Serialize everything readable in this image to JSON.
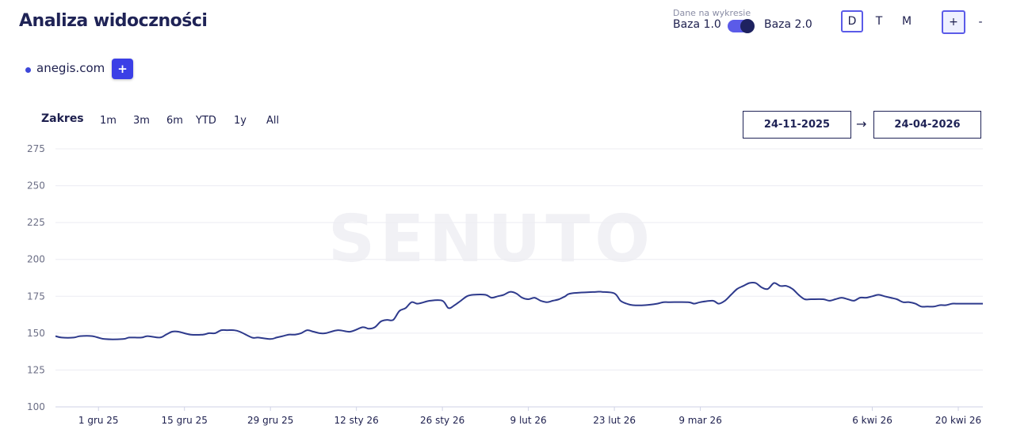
{
  "header": {
    "title": "Analiza widoczności",
    "data_label": "Dane na wykresie",
    "baza1": "Baza 1.0",
    "baza2": "Baza 2.0",
    "granularity": [
      "D",
      "T",
      "M"
    ],
    "granularity_active": "D",
    "zoom_in": "+",
    "zoom_out": "-"
  },
  "domain": {
    "name": "anegis.com",
    "add_label": "+",
    "color": "#3d47d9"
  },
  "range": {
    "label": "Zakres",
    "options": [
      "1m",
      "3m",
      "6m",
      "YTD",
      "1y",
      "All"
    ],
    "date_from": "24-11-2025",
    "arrow": "→",
    "date_to": "24-04-2026"
  },
  "watermark": "SENUTO",
  "chart_data": {
    "type": "line",
    "ylim": [
      100,
      275
    ],
    "y_ticks": [
      100,
      125,
      150,
      175,
      200,
      225,
      250,
      275
    ],
    "x_range": [
      "2025-11-24",
      "2026-04-24"
    ],
    "x_ticks": [
      {
        "label": "1 gru 25",
        "date": "2025-12-01"
      },
      {
        "label": "15 gru 25",
        "date": "2025-12-15"
      },
      {
        "label": "29 gru 25",
        "date": "2025-12-29"
      },
      {
        "label": "12 sty 26",
        "date": "2026-01-12"
      },
      {
        "label": "26 sty 26",
        "date": "2026-01-26"
      },
      {
        "label": "9 lut 26",
        "date": "2026-02-09"
      },
      {
        "label": "23 lut 26",
        "date": "2026-02-23"
      },
      {
        "label": "9 mar 26",
        "date": "2026-03-09"
      },
      {
        "label": "6 kwi 26",
        "date": "2026-04-06"
      },
      {
        "label": "20 kwi 26",
        "date": "2026-04-20"
      }
    ],
    "series": [
      {
        "color": "#2e3a8c",
        "points": [
          [
            "2025-11-24",
            148
          ],
          [
            "2025-11-25",
            147
          ],
          [
            "2025-11-27",
            147
          ],
          [
            "2025-11-28",
            148
          ],
          [
            "2025-11-30",
            148
          ],
          [
            "2025-12-02",
            146
          ],
          [
            "2025-12-05",
            146
          ],
          [
            "2025-12-06",
            147
          ],
          [
            "2025-12-08",
            147
          ],
          [
            "2025-12-09",
            148
          ],
          [
            "2025-12-11",
            147
          ],
          [
            "2025-12-12",
            149
          ],
          [
            "2025-12-13",
            151
          ],
          [
            "2025-12-14",
            151
          ],
          [
            "2025-12-16",
            149
          ],
          [
            "2025-12-18",
            149
          ],
          [
            "2025-12-19",
            150
          ],
          [
            "2025-12-20",
            150
          ],
          [
            "2025-12-21",
            152
          ],
          [
            "2025-12-22",
            152
          ],
          [
            "2025-12-23",
            152
          ],
          [
            "2025-12-24",
            151
          ],
          [
            "2025-12-26",
            147
          ],
          [
            "2025-12-27",
            147
          ],
          [
            "2025-12-29",
            146
          ],
          [
            "2025-12-30",
            147
          ],
          [
            "2025-12-31",
            148
          ],
          [
            "2026-01-01",
            149
          ],
          [
            "2026-01-02",
            149
          ],
          [
            "2026-01-03",
            150
          ],
          [
            "2026-01-04",
            152
          ],
          [
            "2026-01-05",
            151
          ],
          [
            "2026-01-06",
            150
          ],
          [
            "2026-01-07",
            150
          ],
          [
            "2026-01-09",
            152
          ],
          [
            "2026-01-11",
            151
          ],
          [
            "2026-01-13",
            154
          ],
          [
            "2026-01-14",
            153
          ],
          [
            "2026-01-15",
            154
          ],
          [
            "2026-01-16",
            158
          ],
          [
            "2026-01-17",
            159
          ],
          [
            "2026-01-18",
            159
          ],
          [
            "2026-01-19",
            165
          ],
          [
            "2026-01-20",
            167
          ],
          [
            "2026-01-21",
            171
          ],
          [
            "2026-01-22",
            170
          ],
          [
            "2026-01-24",
            172
          ],
          [
            "2026-01-26",
            172
          ],
          [
            "2026-01-27",
            167
          ],
          [
            "2026-01-28",
            169
          ],
          [
            "2026-01-29",
            172
          ],
          [
            "2026-01-30",
            175
          ],
          [
            "2026-01-31",
            176
          ],
          [
            "2026-02-02",
            176
          ],
          [
            "2026-02-03",
            174
          ],
          [
            "2026-02-04",
            175
          ],
          [
            "2026-02-05",
            176
          ],
          [
            "2026-02-06",
            178
          ],
          [
            "2026-02-07",
            177
          ],
          [
            "2026-02-08",
            174
          ],
          [
            "2026-02-09",
            173
          ],
          [
            "2026-02-10",
            174
          ],
          [
            "2026-02-11",
            172
          ],
          [
            "2026-02-12",
            171
          ],
          [
            "2026-02-13",
            172
          ],
          [
            "2026-02-14",
            173
          ],
          [
            "2026-02-15",
            175
          ],
          [
            "2026-02-16",
            177
          ],
          [
            "2026-02-20",
            178
          ],
          [
            "2026-02-21",
            178
          ],
          [
            "2026-02-23",
            177
          ],
          [
            "2026-02-24",
            172
          ],
          [
            "2026-02-25",
            170
          ],
          [
            "2026-02-26",
            169
          ],
          [
            "2026-02-28",
            169
          ],
          [
            "2026-03-02",
            170
          ],
          [
            "2026-03-03",
            171
          ],
          [
            "2026-03-04",
            171
          ],
          [
            "2026-03-07",
            171
          ],
          [
            "2026-03-08",
            170
          ],
          [
            "2026-03-09",
            171
          ],
          [
            "2026-03-11",
            172
          ],
          [
            "2026-03-12",
            170
          ],
          [
            "2026-03-13",
            172
          ],
          [
            "2026-03-14",
            176
          ],
          [
            "2026-03-15",
            180
          ],
          [
            "2026-03-16",
            182
          ],
          [
            "2026-03-17",
            184
          ],
          [
            "2026-03-18",
            184
          ],
          [
            "2026-03-19",
            181
          ],
          [
            "2026-03-20",
            180
          ],
          [
            "2026-03-21",
            184
          ],
          [
            "2026-03-22",
            182
          ],
          [
            "2026-03-23",
            182
          ],
          [
            "2026-03-24",
            180
          ],
          [
            "2026-03-25",
            176
          ],
          [
            "2026-03-26",
            173
          ],
          [
            "2026-03-27",
            173
          ],
          [
            "2026-03-29",
            173
          ],
          [
            "2026-03-30",
            172
          ],
          [
            "2026-03-31",
            173
          ],
          [
            "2026-04-01",
            174
          ],
          [
            "2026-04-02",
            173
          ],
          [
            "2026-04-03",
            172
          ],
          [
            "2026-04-04",
            174
          ],
          [
            "2026-04-05",
            174
          ],
          [
            "2026-04-06",
            175
          ],
          [
            "2026-04-07",
            176
          ],
          [
            "2026-04-08",
            175
          ],
          [
            "2026-04-09",
            174
          ],
          [
            "2026-04-10",
            173
          ],
          [
            "2026-04-11",
            171
          ],
          [
            "2026-04-12",
            171
          ],
          [
            "2026-04-13",
            170
          ],
          [
            "2026-04-14",
            168
          ],
          [
            "2026-04-15",
            168
          ],
          [
            "2026-04-16",
            168
          ],
          [
            "2026-04-17",
            169
          ],
          [
            "2026-04-18",
            169
          ],
          [
            "2026-04-19",
            170
          ],
          [
            "2026-04-20",
            170
          ],
          [
            "2026-04-24",
            170
          ]
        ]
      }
    ]
  }
}
